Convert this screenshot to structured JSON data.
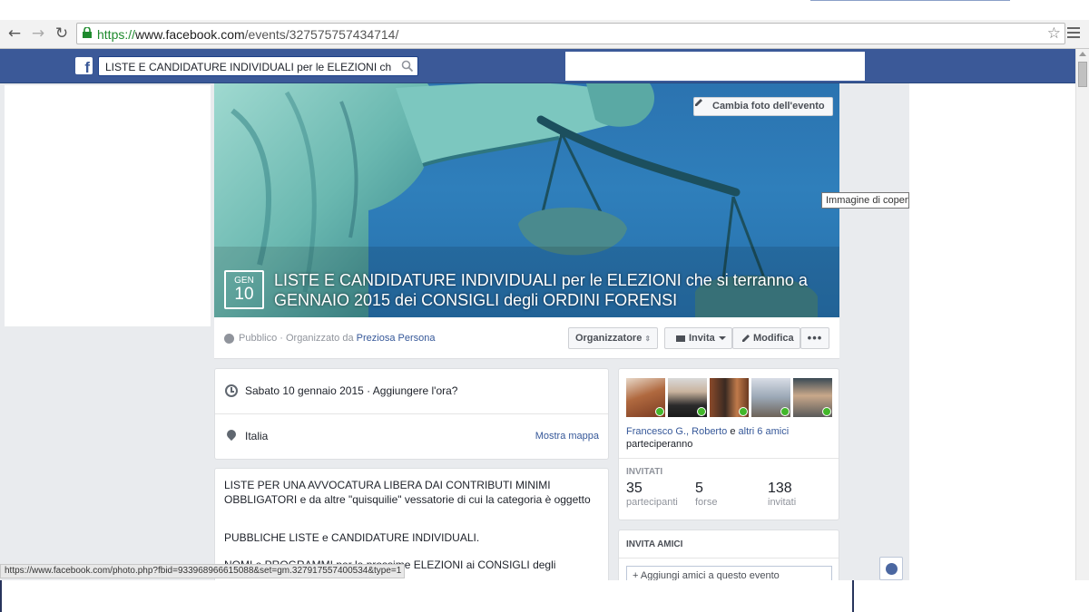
{
  "browser": {
    "url_scheme": "https://",
    "url_host": "www.facebook.com",
    "url_path": "/events/327575757434714/",
    "status_url": "https://www.facebook.com/photo.php?fbid=933968966615088&set=gm.327917557400534&type=1"
  },
  "header": {
    "search_value": "LISTE E CANDIDATURE INDIVIDUALI per le ELEZIONI ch"
  },
  "cover": {
    "change_photo_label": "Cambia foto dell'evento",
    "tooltip": "Immagine di copert",
    "date_month": "GEN",
    "date_day": "10",
    "title": "LISTE E CANDIDATURE INDIVIDUALI per le ELEZIONI che si terranno a GENNAIO 2015 dei CONSIGLI degli ORDINI FORENSI"
  },
  "info_bar": {
    "privacy": "Pubblico · Organizzato da ",
    "organizer": "Preziosa Persona",
    "buttons": {
      "organizer": "Organizzatore",
      "invite": "Invita",
      "edit": "Modifica",
      "more": "•••"
    }
  },
  "details": {
    "date": "Sabato 10 gennaio 2015 · Aggiungere l'ora?",
    "place": "Italia",
    "map_link": "Mostra mappa"
  },
  "description": {
    "p1": "LISTE PER UNA AVVOCATURA LIBERA DAI CONTRIBUTI MINIMI OBBLIGATORI e da altre \"quisquilie\" vessatorie di cui la categoria è oggetto",
    "p2": "PUBBLICHE LISTE e CANDIDATURE INDIVIDUALI.",
    "p3": "NOMI e PROGRAMMI per le prossime ELEZIONI ai CONSIGLI degli"
  },
  "friends": {
    "names_link": "Francesco G., Roberto",
    "conj": " e ",
    "others_link": "altri 6 amici",
    "attending": "parteciperanno",
    "invited_label": "INVITATI",
    "stats": [
      {
        "num": "35",
        "label": "partecipanti"
      },
      {
        "num": "5",
        "label": "forse"
      },
      {
        "num": "138",
        "label": "invitati"
      }
    ]
  },
  "invite": {
    "title": "INVITA AMICI",
    "placeholder": "+ Aggiungi amici a questo evento"
  },
  "colors": {
    "fb_blue": "#3b5998",
    "link": "#365899",
    "check_green": "#42b72a"
  }
}
